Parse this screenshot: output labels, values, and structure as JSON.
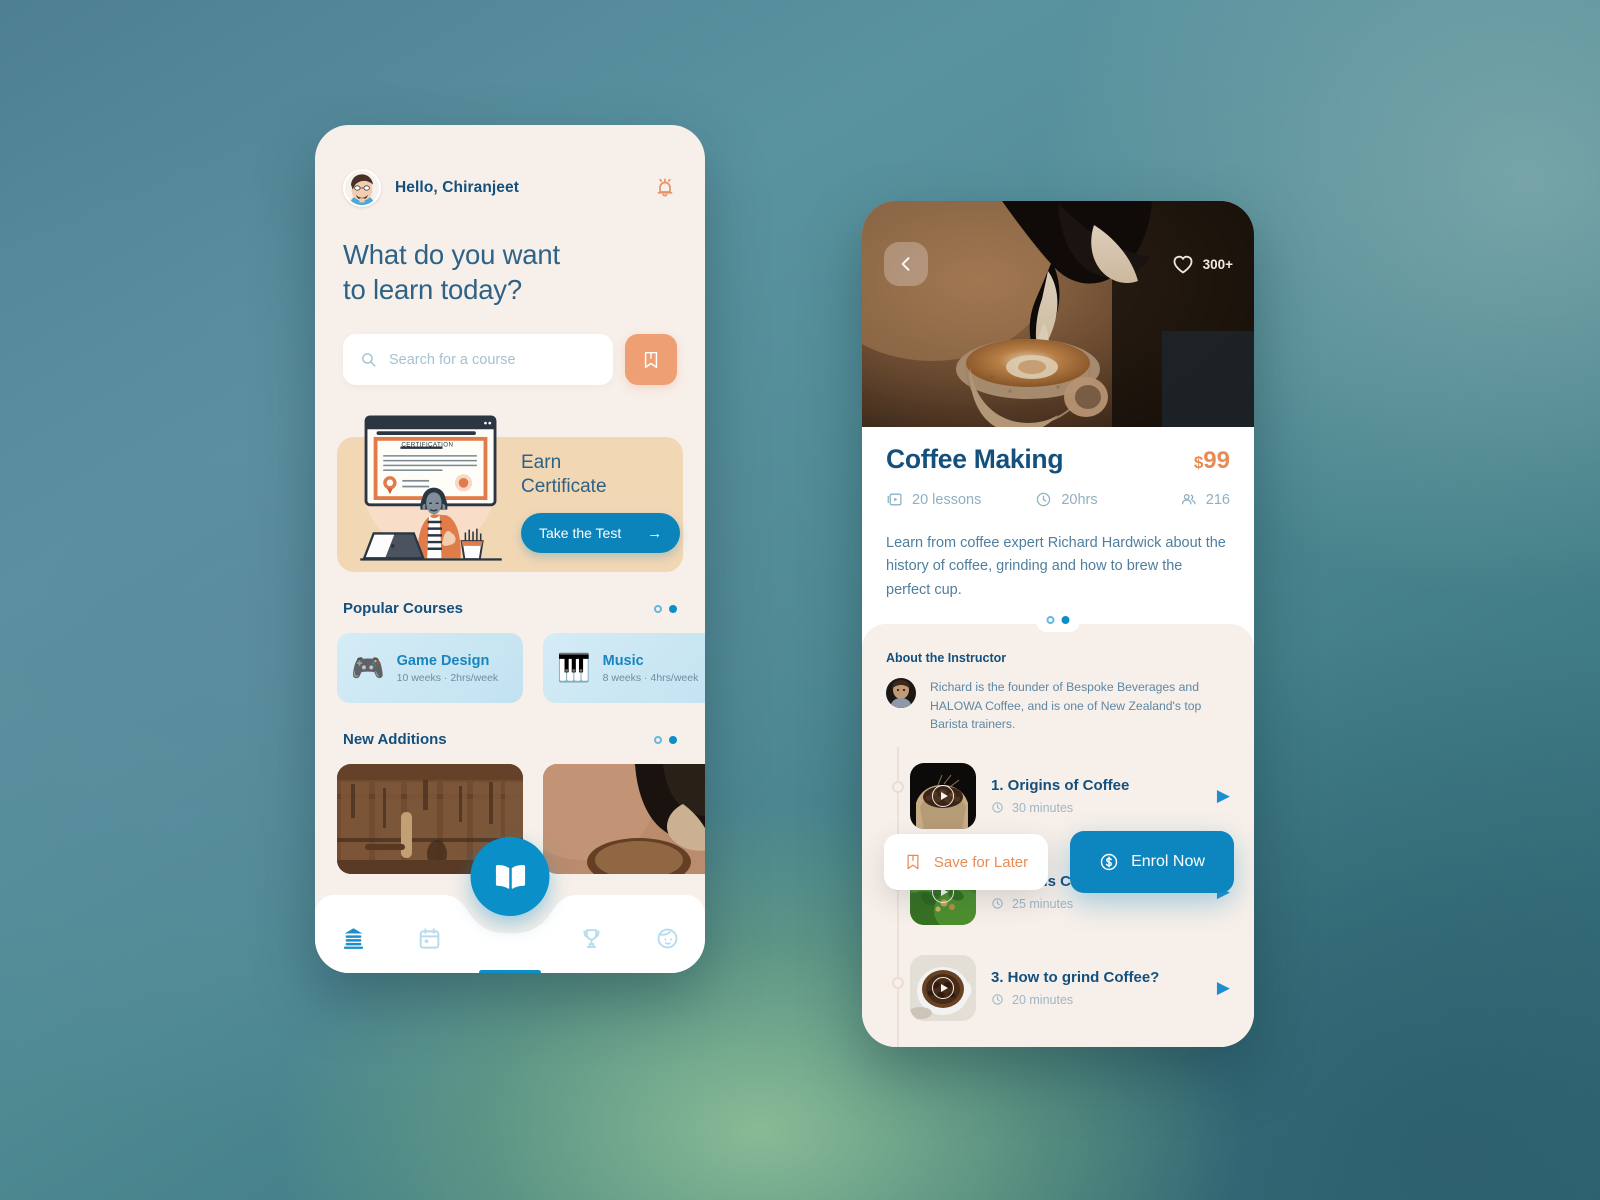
{
  "home": {
    "greeting": "Hello, Chiranjeet",
    "notification_icon": "bell-icon",
    "headline_line1": "What do you want",
    "headline_line2": "to learn today?",
    "search": {
      "placeholder": "Search for a course",
      "value": "",
      "icon": "search-icon"
    },
    "bookmark_icon": "bookmark-icon",
    "banner": {
      "title_line1": "Earn",
      "title_line2": "Certificate",
      "certificate_label": "CERTIFICATION",
      "cta_label": "Take the Test",
      "cta_arrow": "→"
    },
    "popular": {
      "title": "Popular Courses",
      "courses": [
        {
          "emoji": "🎮",
          "name": "Game Design",
          "meta": "10 weeks · 2hrs/week"
        },
        {
          "emoji": "🎹",
          "name": "Music",
          "meta": "8 weeks · 4hrs/week"
        }
      ]
    },
    "new_additions": {
      "title": "New Additions",
      "items": [
        {
          "alt": "workshop-tools-photo"
        },
        {
          "alt": "coffee-pour-photo"
        }
      ]
    },
    "nav": [
      {
        "name": "home",
        "icon": "books-icon",
        "active": true
      },
      {
        "name": "calendar",
        "icon": "calendar-icon",
        "active": false
      },
      {
        "name": "library",
        "icon": "open-book-icon",
        "active": true
      },
      {
        "name": "achievements",
        "icon": "trophy-icon",
        "active": false
      },
      {
        "name": "profile",
        "icon": "face-icon",
        "active": false
      }
    ]
  },
  "detail": {
    "hero": {
      "back_icon": "chevron-left-icon",
      "like_icon": "heart-icon",
      "likes": "300+",
      "alt": "latte-art-pour-photo"
    },
    "title": "Coffee Making",
    "price_currency": "$",
    "price_amount": "99",
    "stats": [
      {
        "icon": "video-lessons-icon",
        "label": "20 lessons"
      },
      {
        "icon": "clock-icon",
        "label": "20hrs"
      },
      {
        "icon": "people-icon",
        "label": "216"
      }
    ],
    "description": "Learn from coffee expert Richard Hardwick about the history of coffee, grinding and how to brew the perfect cup.",
    "instructor": {
      "heading": "About the Instructor",
      "bio": "Richard is the founder of Bespoke Beverages and HALOWA Coffee, and is one of New Zealand's top Barista trainers.",
      "avatar_alt": "instructor-portrait"
    },
    "lessons": [
      {
        "title": "1. Origins of Coffee",
        "duration": "30 minutes",
        "thumb": "coffee-beans-sack",
        "play_icon": "play-icon"
      },
      {
        "title": "2. How is Coffee plucked?",
        "duration": "25 minutes",
        "thumb": "coffee-plantation",
        "play_icon": "play-icon"
      },
      {
        "title": "3. How to grind Coffee?",
        "duration": "20 minutes",
        "thumb": "ground-coffee-cup",
        "play_icon": "play-icon"
      }
    ],
    "actions": {
      "save_label": "Save for Later",
      "save_icon": "bookmark-icon",
      "enrol_label": "Enrol Now",
      "enrol_icon": "dollar-coin-icon"
    }
  },
  "colors": {
    "brand_blue": "#0b8fc9",
    "deep_blue": "#13507e",
    "accent_orange": "#e98b55",
    "cream": "#f7efe9",
    "banner_tan": "#f2d7b4"
  }
}
